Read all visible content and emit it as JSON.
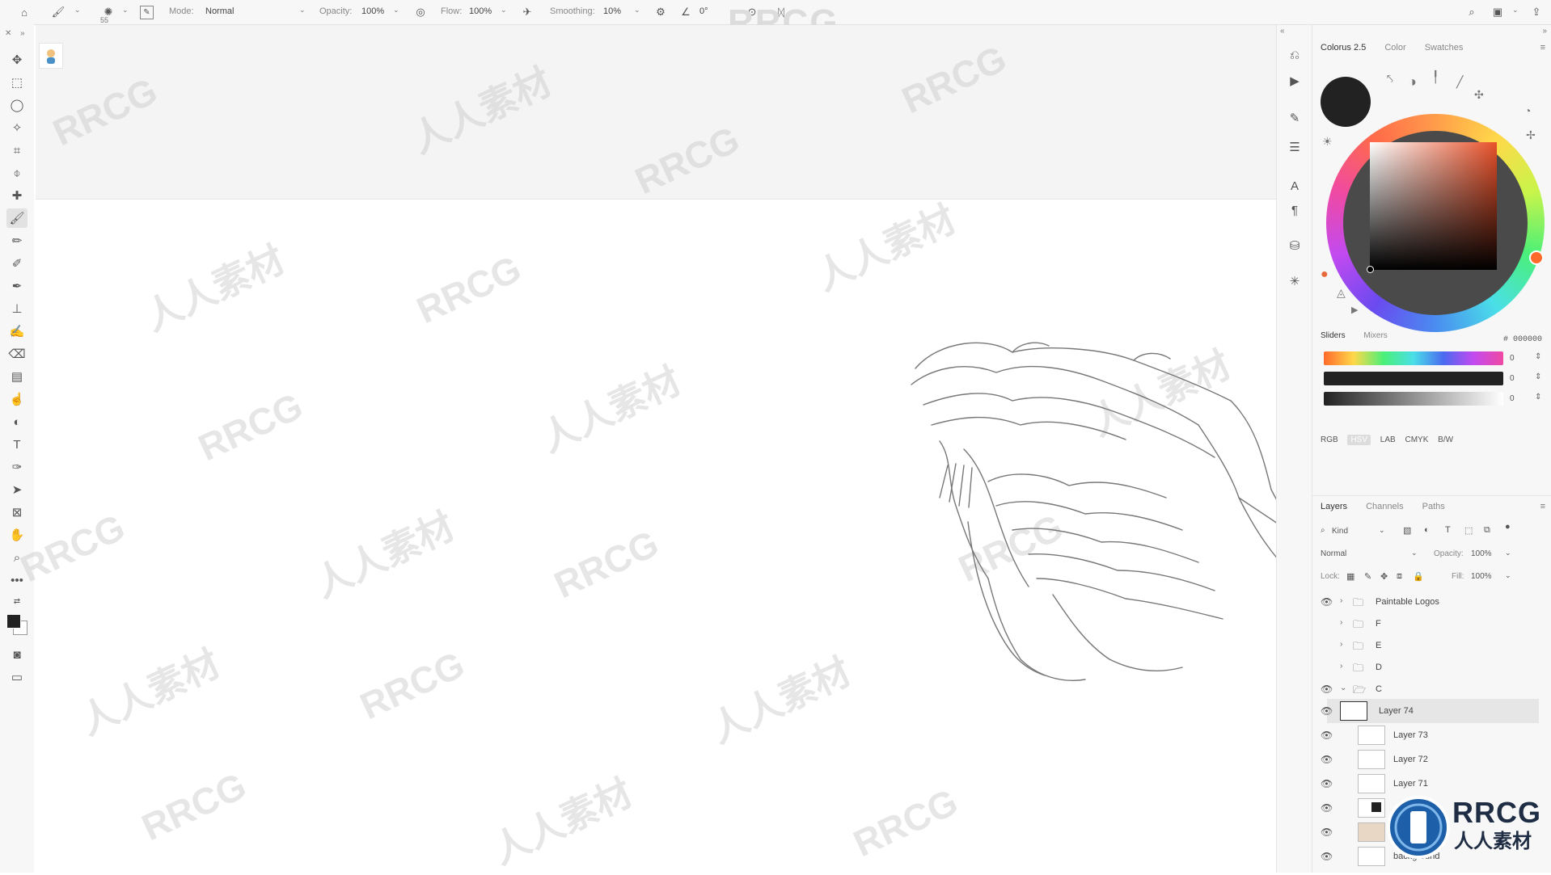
{
  "options_bar": {
    "brush_size": "55",
    "mode_label": "Mode:",
    "mode_value": "Normal",
    "opacity_label": "Opacity:",
    "opacity_value": "100%",
    "flow_label": "Flow:",
    "flow_value": "100%",
    "smoothing_label": "Smoothing:",
    "smoothing_value": "10%",
    "angle_value": "0°"
  },
  "watermark": {
    "top": "RRCG",
    "repeat_latin": "RRCG",
    "repeat_cjk": "人人素材"
  },
  "color_panel": {
    "tabs": [
      "Colorus 2.5",
      "Color",
      "Swatches"
    ],
    "hex_value": "# 000000",
    "slider_tabs": [
      "Sliders",
      "Mixers"
    ],
    "slider_values": [
      "0",
      "0",
      "0"
    ],
    "modes": [
      "RGB",
      "HSV",
      "LAB",
      "CMYK",
      "B/W"
    ],
    "selected_mode": "HSV",
    "foreground_color": "#222222"
  },
  "layers_panel": {
    "tabs": [
      "Layers",
      "Channels",
      "Paths"
    ],
    "kind_label": "Kind",
    "blend_mode": "Normal",
    "opacity_label": "Opacity:",
    "opacity_value": "100%",
    "lock_label": "Lock:",
    "fill_label": "Fill:",
    "fill_value": "100%",
    "groups": [
      "Paintable Logos",
      "F",
      "E",
      "D",
      "C"
    ],
    "layers": [
      "Layer 74",
      "Layer 73",
      "Layer 72",
      "Layer 71",
      "background"
    ]
  },
  "logo": {
    "title": "RRCG",
    "subtitle": "人人素材"
  }
}
